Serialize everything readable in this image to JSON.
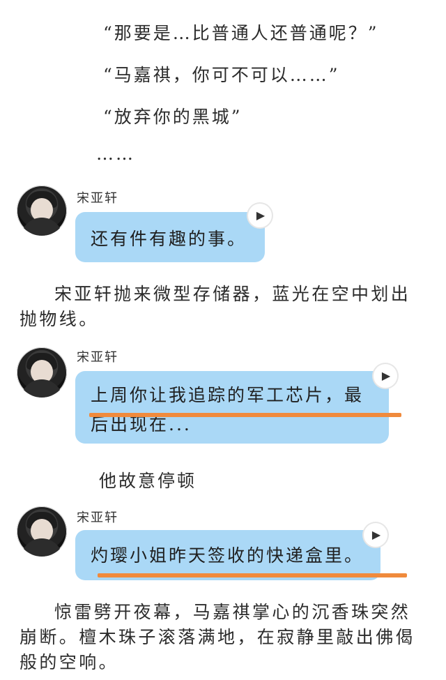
{
  "story": {
    "quote1": "“那要是…比普通人还普通呢？”",
    "quote2": "“马嘉祺，你可不可以……”",
    "quote3": "“放弃你的黑城”",
    "ellipsis": "……",
    "para1": "宋亚轩抛来微型存储器，蓝光在空中划出抛物线。",
    "para2": "他故意停顿",
    "para3": "惊雷劈开夜幕，马嘉祺掌心的沉香珠突然崩断。檀木珠子滚落满地，在寂静里敲出佛偈般的空响。"
  },
  "messages": [
    {
      "sender": "宋亚轩",
      "text": "还有件有趣的事。"
    },
    {
      "sender": "宋亚轩",
      "text": "上周你让我追踪的军工芯片，最后出现在..."
    },
    {
      "sender": "宋亚轩",
      "text": "灼璎小姐昨天签收的快递盒里。"
    }
  ],
  "colors": {
    "bubble": "#aad8f6",
    "underline": "#f08a3c"
  },
  "icons": {
    "play": "play-icon",
    "avatar": "avatar-icon"
  }
}
